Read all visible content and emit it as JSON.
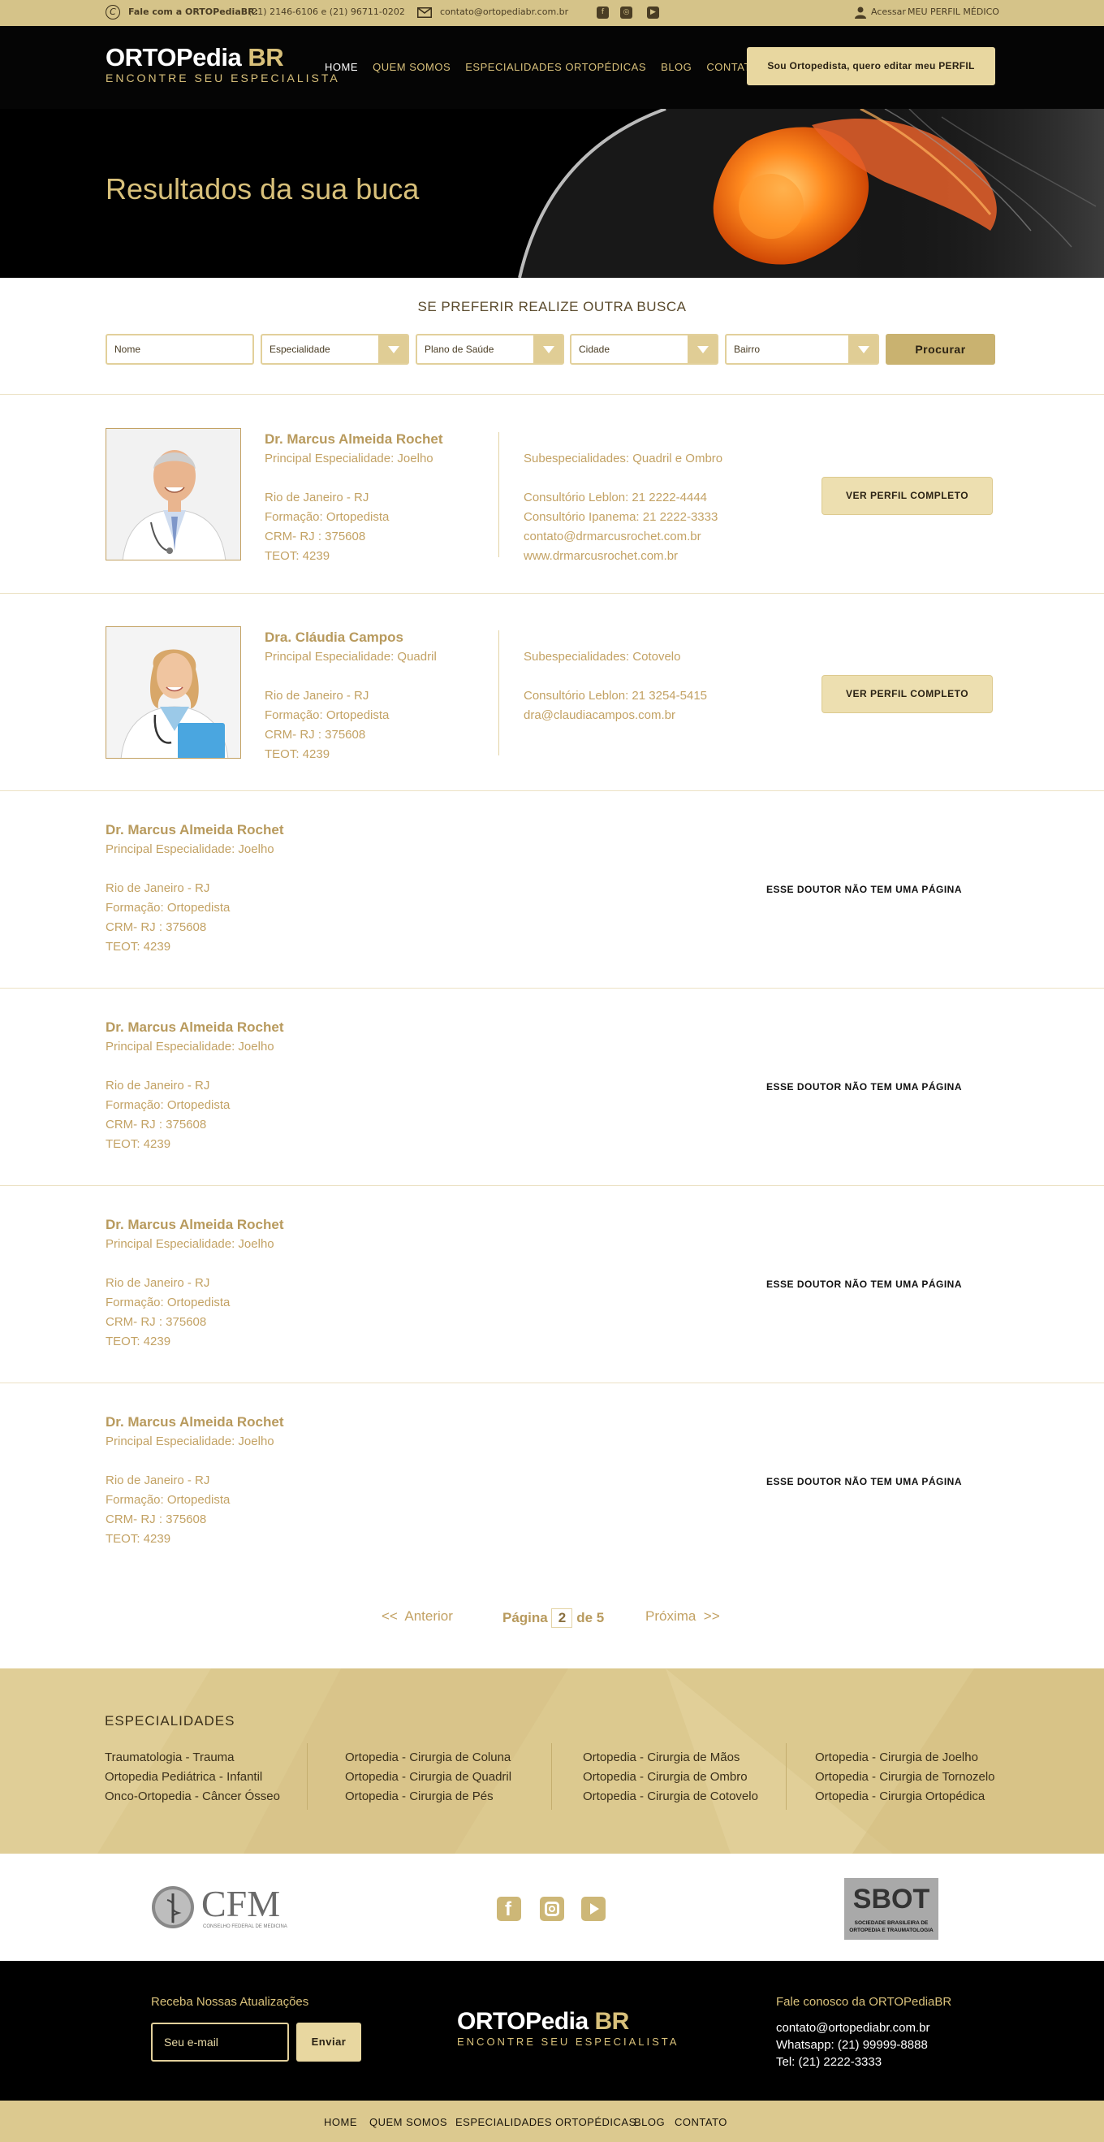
{
  "topbar": {
    "phone_label": "Fale com a ORTOPediaBR:",
    "phone_numbers": "(21) 2146-6106 e (21) 96711-0202",
    "email": "contato@ortopediabr.com.br",
    "access_prefix": "Acessar",
    "access_label": "MEU PERFIL MÉDICO",
    "icons": [
      "phone-icon",
      "mail-icon",
      "facebook-icon",
      "instagram-icon",
      "youtube-icon",
      "user-icon"
    ]
  },
  "header": {
    "logo_main": "ORTOPedia",
    "logo_br": "BR",
    "logo_sub": "ENCONTRE SEU ESPECIALISTA",
    "nav": [
      "HOME",
      "QUEM SOMOS",
      "ESPECIALIDADES ORTOPÉDICAS",
      "BLOG",
      "CONTATO"
    ],
    "cta": "Sou Ortopedista, quero editar meu PERFIL"
  },
  "hero": {
    "title": "Resultados da sua buca"
  },
  "search": {
    "title": "SE PREFERIR REALIZE OUTRA BUSCA",
    "fields": [
      "Nome",
      "Especialidade",
      "Plano de Saúde",
      "Cidade",
      "Bairro"
    ],
    "button": "Procurar"
  },
  "results": [
    {
      "name": "Dr. Marcus Almeida Rochet",
      "specialty": "Principal Especialidade: Joelho",
      "location": "Rio de Janeiro - RJ",
      "formation": "Formação: Ortopedista",
      "crm": "CRM- RJ : 375608",
      "teot": "TEOT: 4239",
      "subspecialties": "Subespecialidades: Quadril e Ombro",
      "contacts": [
        "Consultório Leblon: 21 2222-4444",
        "Consultório Ipanema: 21 2222-3333",
        "contato@drmarcusrochet.com.br",
        "www.drmarcusrochet.com.br"
      ],
      "button": "VER PERFIL COMPLETO"
    },
    {
      "name": "Dra. Cláudia Campos",
      "specialty": "Principal Especialidade: Quadril",
      "location": "Rio de Janeiro - RJ",
      "formation": "Formação: Ortopedista",
      "crm": "CRM- RJ : 375608",
      "teot": "TEOT: 4239",
      "subspecialties": "Subespecialidades: Cotovelo",
      "contacts": [
        "Consultório Leblon: 21 3254-5415",
        "dra@claudiacampos.com.br"
      ],
      "button": "VER PERFIL COMPLETO"
    },
    {
      "name": "Dr. Marcus Almeida Rochet",
      "specialty": "Principal Especialidade: Joelho",
      "location": "Rio de Janeiro - RJ",
      "formation": "Formação: Ortopedista",
      "crm": "CRM- RJ : 375608",
      "teot": "TEOT: 4239",
      "note": "ESSE DOUTOR NÃO TEM UMA PÁGINA"
    },
    {
      "name": "Dr. Marcus Almeida Rochet",
      "specialty": "Principal Especialidade: Joelho",
      "location": "Rio de Janeiro - RJ",
      "formation": "Formação: Ortopedista",
      "crm": "CRM- RJ : 375608",
      "teot": "TEOT: 4239",
      "note": "ESSE DOUTOR NÃO TEM UMA PÁGINA"
    },
    {
      "name": "Dr. Marcus Almeida Rochet",
      "specialty": "Principal Especialidade: Joelho",
      "location": "Rio de Janeiro - RJ",
      "formation": "Formação: Ortopedista",
      "crm": "CRM- RJ : 375608",
      "teot": "TEOT: 4239",
      "note": "ESSE DOUTOR NÃO TEM UMA PÁGINA"
    },
    {
      "name": "Dr. Marcus Almeida Rochet",
      "specialty": "Principal Especialidade: Joelho",
      "location": "Rio de Janeiro - RJ",
      "formation": "Formação: Ortopedista",
      "crm": "CRM- RJ : 375608",
      "teot": "TEOT: 4239",
      "note": "ESSE DOUTOR NÃO TEM UMA PÁGINA"
    }
  ],
  "pagination": {
    "prev": "<<  Anterior",
    "page_label": "Página",
    "current": "2",
    "of_label": "de 5",
    "next": "Próxima  >>"
  },
  "specialties": {
    "title": "ESPECIALIDADES",
    "columns": [
      [
        "Traumatologia - Trauma",
        "Ortopedia Pediátrica - Infantil",
        "Onco-Ortopedia - Câncer Ósseo"
      ],
      [
        "Ortopedia - Cirurgia de Coluna",
        "Ortopedia - Cirurgia de Quadril",
        "Ortopedia - Cirurgia de Pés"
      ],
      [
        "Ortopedia - Cirurgia de Mãos",
        "Ortopedia - Cirurgia de Ombro",
        "Ortopedia - Cirurgia de Cotovelo"
      ],
      [
        "Ortopedia - Cirurgia de Joelho",
        "Ortopedia - Cirurgia de Tornozelo",
        "Ortopedia - Cirurgia Ortopédica"
      ]
    ]
  },
  "partners": {
    "cfm_name": "CFM",
    "cfm_sub": "CONSELHO FEDERAL DE MEDICINA",
    "sbot_name": "SBOT",
    "sbot_sub1": "SOCIEDADE BRASILEIRA DE",
    "sbot_sub2": "ORTOPEDIA E TRAUMATOLOGIA"
  },
  "footer": {
    "newsletter_title": "Receba Nossas Atualizações",
    "email_placeholder": "Seu e-mail",
    "send": "Enviar",
    "contact_title": "Fale conosco da ORTOPediaBR",
    "contact_email": "contato@ortopediabr.com.br",
    "whatsapp": "Whatsapp: (21) 99999-8888",
    "tel": "Tel: (21) 2222-3333"
  },
  "bottom_nav": [
    "HOME",
    "QUEM SOMOS",
    "ESPECIALIDADES ORTOPÉDICAS",
    "BLOG",
    "CONTATO"
  ],
  "colors": {
    "gold": "#d5c389",
    "gold_text": "#c3a264",
    "dark": "#050505"
  }
}
